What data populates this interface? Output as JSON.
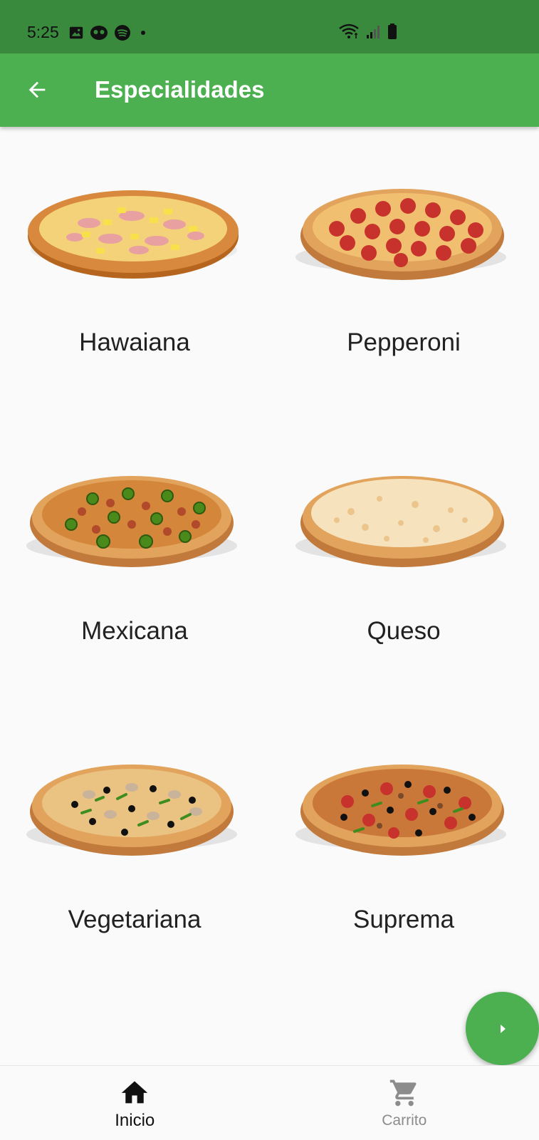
{
  "status_bar": {
    "time": "5:25",
    "left_icons": [
      "image-icon",
      "mask-icon",
      "spotify-icon",
      "dot-icon"
    ],
    "right_icons": [
      "wifi-icon",
      "signal-icon",
      "battery-icon"
    ]
  },
  "app_bar": {
    "title": "Especialidades",
    "back_icon": "arrow-left-icon"
  },
  "specialties": [
    {
      "name": "Hawaiana"
    },
    {
      "name": "Pepperoni"
    },
    {
      "name": "Mexicana"
    },
    {
      "name": "Queso"
    },
    {
      "name": "Vegetariana"
    },
    {
      "name": "Suprema"
    }
  ],
  "fab": {
    "icon": "play-arrow-icon"
  },
  "bottom_nav": {
    "items": [
      {
        "label": "Inicio",
        "icon": "home-icon",
        "active": true
      },
      {
        "label": "Carrito",
        "icon": "cart-icon",
        "active": false
      }
    ]
  },
  "colors": {
    "primary": "#4caf50",
    "primary_dark": "#3a8a3e",
    "background": "#fafafa",
    "text": "#212121",
    "inactive": "#8c8c8c"
  }
}
